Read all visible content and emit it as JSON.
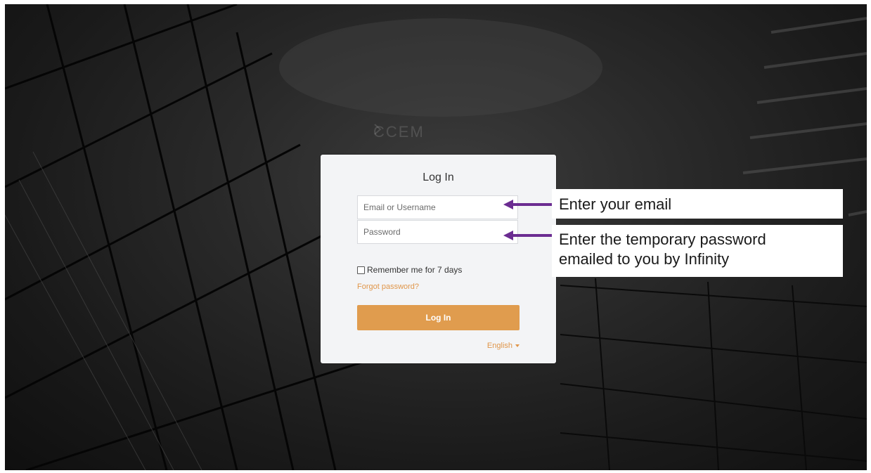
{
  "background": {
    "logo_text": "CCEM"
  },
  "login": {
    "title": "Log In",
    "email_placeholder": "Email or Username",
    "password_placeholder": "Password",
    "remember_label": "Remember me for 7 days",
    "remember_checked": false,
    "forgot_label": "Forgot password?",
    "submit_label": "Log In",
    "language": "English"
  },
  "annotations": {
    "email_callout": "Enter your email",
    "password_callout_line1": "Enter the temporary password",
    "password_callout_line2": "emailed to you by Infinity",
    "arrow_color": "#6b2c91"
  },
  "colors": {
    "accent": "#e09c4e",
    "card_bg": "#f3f4f6"
  }
}
